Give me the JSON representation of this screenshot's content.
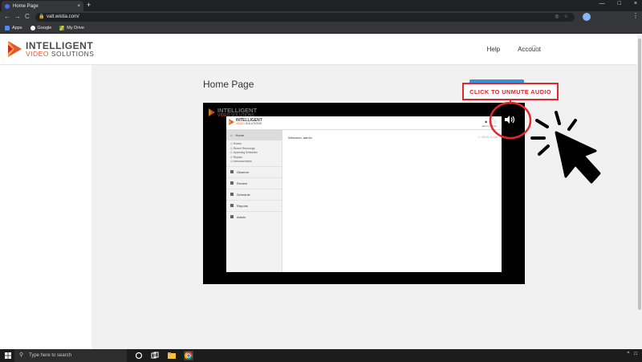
{
  "browser": {
    "tab_title": "Home Page",
    "tab_close": "×",
    "new_tab": "+",
    "window_controls": [
      "—",
      "□",
      "×"
    ],
    "nav": {
      "back": "←",
      "forward": "→",
      "reload": "C"
    },
    "url": "valt.wistia.com/",
    "menu": "⋮"
  },
  "bookmarks": [
    {
      "label": "Apps"
    },
    {
      "label": "Google"
    },
    {
      "label": "My Drive"
    }
  ],
  "site": {
    "logo_line1": "INTELLIGENT",
    "logo_line2_a": "VIDEO",
    "logo_line2_b": " SOLUTIONS",
    "nav": [
      "Help",
      "Account"
    ]
  },
  "page": {
    "title": "Home Page"
  },
  "video": {
    "logo_line1": "INTELLIGENT",
    "logo_line2_a": "VIDEO",
    "logo_line2_b": " SOLUTIONS",
    "inner_app": {
      "logo_line1": "INTELLIGENT",
      "logo_line2_a": "VIDEO",
      "logo_line2_b": " SOLUTIONS",
      "home_label": "Home",
      "home_sub": [
        "Rooms",
        "Recent Recordings",
        "Upcoming Schedules",
        "Reports",
        "Announcements"
      ],
      "sections": [
        "Observe",
        "Review",
        "Schedule",
        "Reports",
        "Admin"
      ],
      "welcome": "Welcome, admin",
      "date": "1 / 08:00:10 AM",
      "user": "admin | admin"
    },
    "unmute_label": "CLICK TO UNMUTE AUDIO"
  },
  "taskbar": {
    "search_placeholder": "Type here to search"
  },
  "colors": {
    "brand_orange": "#e4572e",
    "unmute_red": "#e3272b",
    "chrome_dark": "#202124"
  }
}
